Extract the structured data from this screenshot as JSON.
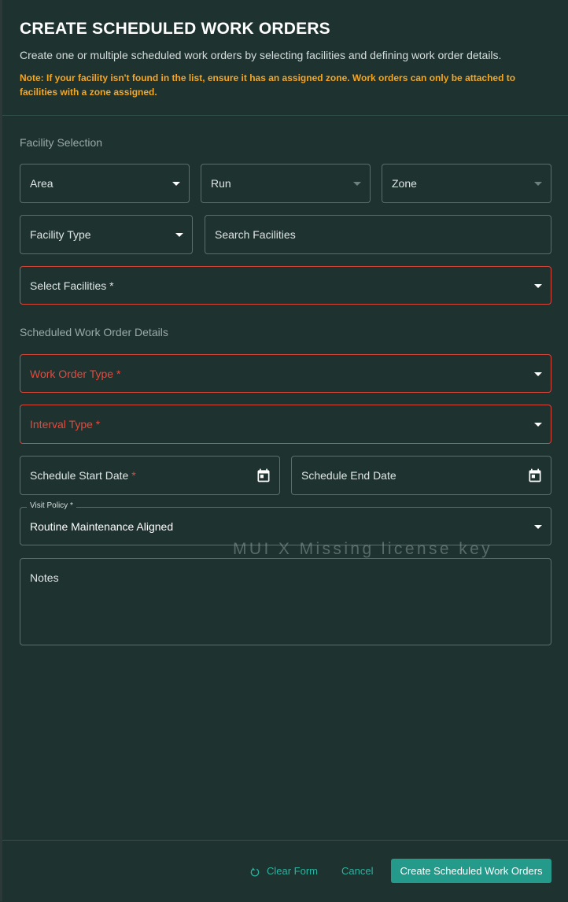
{
  "header": {
    "title": "CREATE SCHEDULED WORK ORDERS",
    "subtitle": "Create one or multiple scheduled work orders by selecting facilities and defining work order details.",
    "note": "Note: If your facility isn't found in the list, ensure it has an assigned zone. Work orders can only be attached to facilities with a zone assigned."
  },
  "facility_selection": {
    "section_label": "Facility Selection",
    "area_label": "Area",
    "run_label": "Run",
    "zone_label": "Zone",
    "facility_type_label": "Facility Type",
    "search_placeholder": "Search Facilities",
    "select_facilities_label": "Select Facilities *"
  },
  "details": {
    "section_label": "Scheduled Work Order Details",
    "work_order_type_label": "Work Order Type *",
    "interval_type_label": "Interval Type *",
    "start_date_label": "Schedule Start Date",
    "required_marker": "*",
    "end_date_label": "Schedule End Date",
    "visit_policy_legend": "Visit Policy *",
    "visit_policy_value": "Routine Maintenance Aligned",
    "notes_label": "Notes"
  },
  "watermark": "MUI X Missing license key",
  "footer": {
    "clear_label": "Clear Form",
    "cancel_label": "Cancel",
    "submit_label": "Create Scheduled Work Orders"
  },
  "colors": {
    "background": "#1e3230",
    "accent": "#239a8a",
    "error": "#e24b3f",
    "note": "#f5a623"
  },
  "icons": {
    "dropdown": "chevron-down-icon",
    "date": "calendar-icon",
    "clear": "refresh-icon"
  }
}
